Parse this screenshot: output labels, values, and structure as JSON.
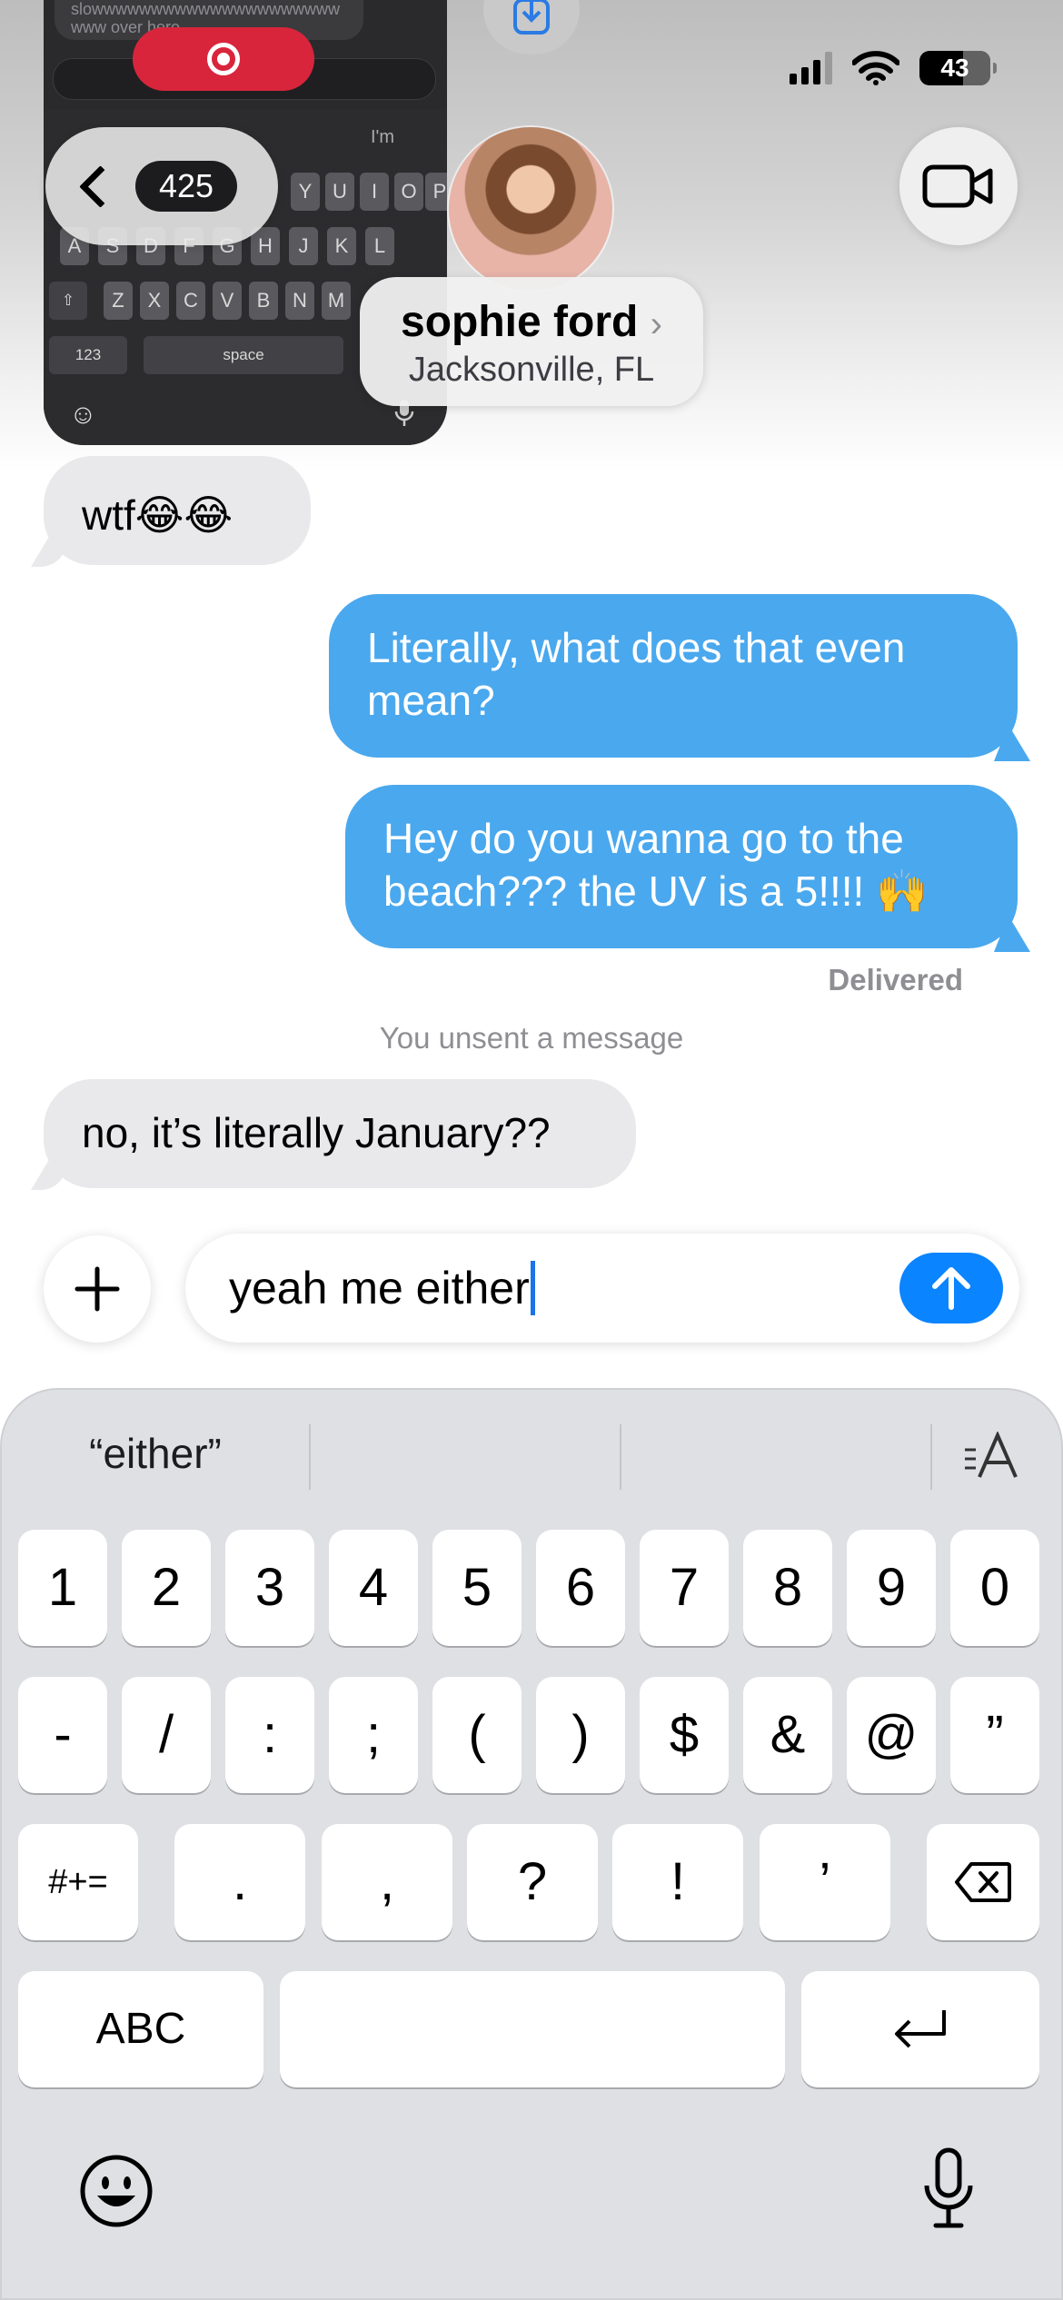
{
  "pip": {
    "bubble_lines": [
      "slowwwwwwwwwwwwwwwwwwwww",
      "www over here..........."
    ],
    "keys_row1": [
      "Y",
      "U",
      "I",
      "O",
      "P"
    ],
    "suggestion": "I'm",
    "keys_row2": [
      "A",
      "S",
      "D",
      "F",
      "G",
      "H",
      "J",
      "K",
      "L"
    ],
    "keys_row3": [
      "Z",
      "X",
      "C",
      "V",
      "B",
      "N",
      "M"
    ],
    "key_123": "123",
    "key_space": "space"
  },
  "status_bar": {
    "battery": "43"
  },
  "header": {
    "unread_count": "425",
    "contact_name": "sophie ford",
    "contact_chevron": "›",
    "contact_location": "Jacksonville, FL"
  },
  "messages": [
    {
      "side": "in",
      "text": "wtf😂😂"
    },
    {
      "side": "out",
      "text": "Literally, what does that even mean?"
    },
    {
      "side": "out",
      "text": "Hey do you wanna go to the beach??? the UV is a 5!!!! 🙌"
    },
    {
      "side": "in",
      "text": "no, it’s literally January??"
    }
  ],
  "delivered_label": "Delivered",
  "unsent_notice": "You unsent a message",
  "compose": {
    "text": "yeah me either"
  },
  "keyboard": {
    "suggestions": [
      "“either”",
      "",
      ""
    ],
    "row1": [
      "1",
      "2",
      "3",
      "4",
      "5",
      "6",
      "7",
      "8",
      "9",
      "0"
    ],
    "row2": [
      "-",
      "/",
      ":",
      ";",
      "(",
      ")",
      "$",
      "&",
      "@",
      "”"
    ],
    "row3_symbols": [
      "#+=",
      ".",
      ",",
      "?",
      "!",
      "’"
    ],
    "abc_label": "ABC"
  },
  "colors": {
    "accent": "#0a84ff",
    "outgoing_bubble": "#4aa8ee",
    "incoming_bubble": "#e9e9eb",
    "record": "#d9253b"
  }
}
